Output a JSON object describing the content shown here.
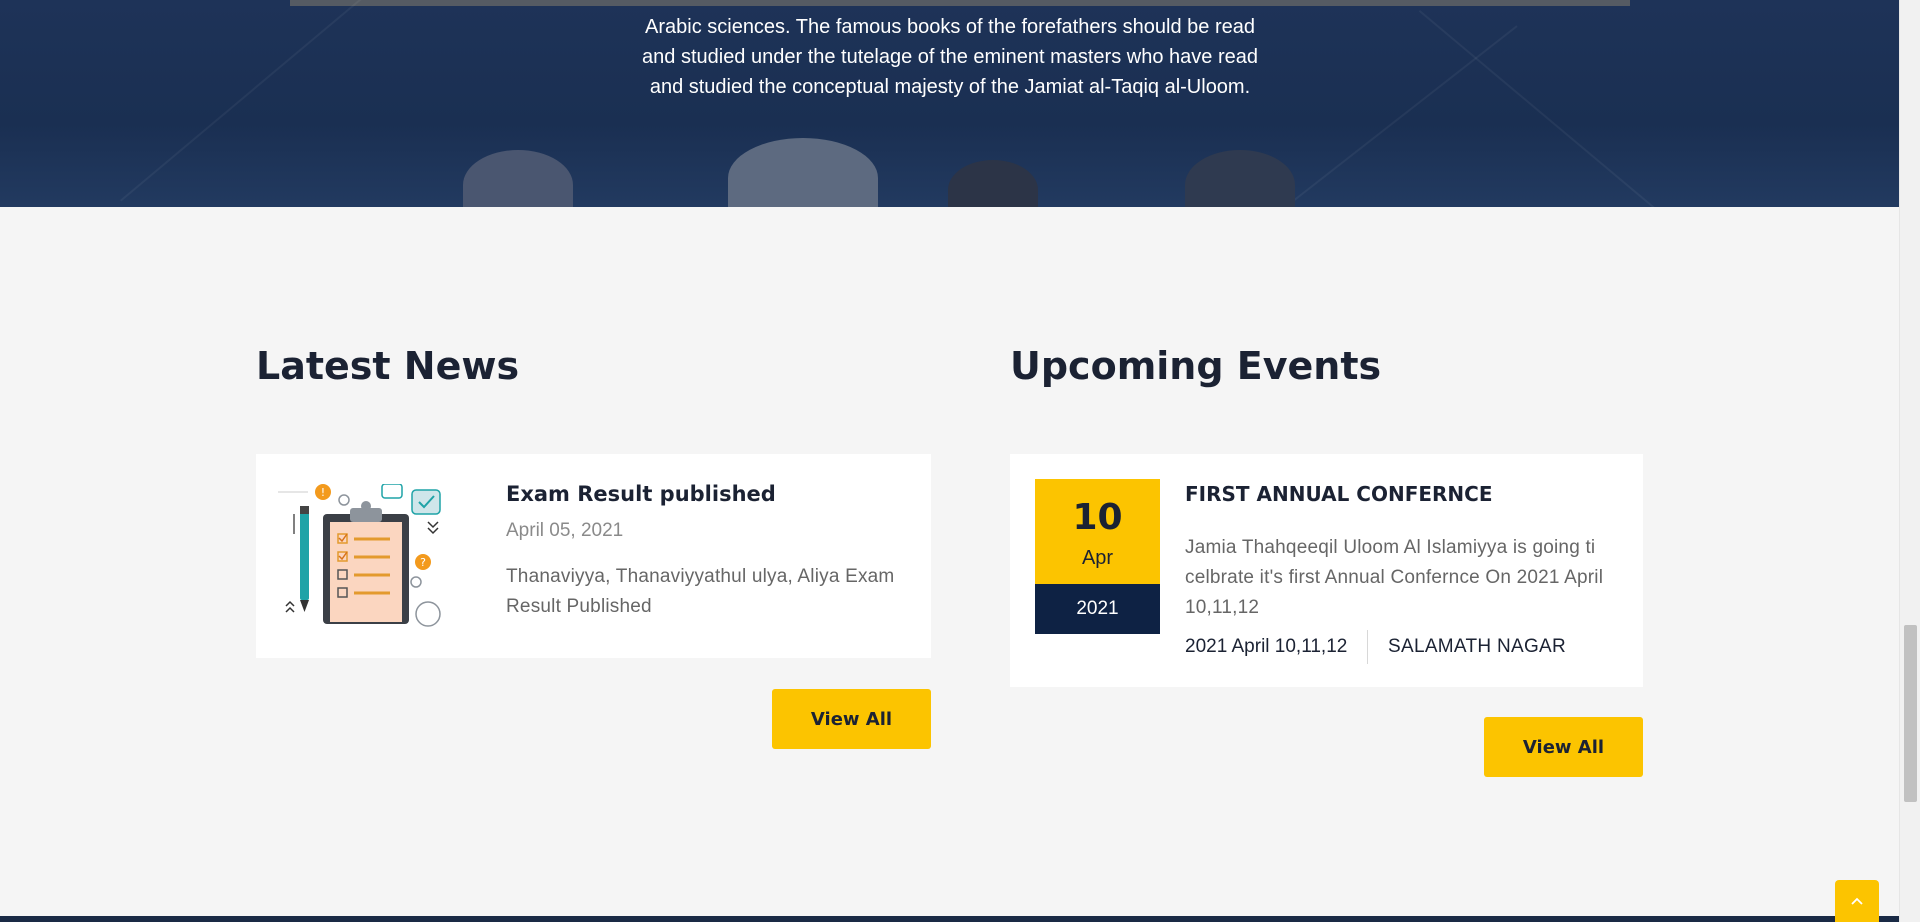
{
  "hero": {
    "lines": [
      "Arabic sciences. The famous books of the forefathers should be read",
      "and studied under the tutelage of the eminent masters who have read",
      "and studied the conceptual majesty of the Jamiat al-Taqiq al-Uloom."
    ]
  },
  "news": {
    "heading": "Latest News",
    "item": {
      "title": "Exam Result published",
      "date": "April 05, 2021",
      "summary": "Thanaviyya, Thanaviyyathul ulya, Aliya Exam Result Published",
      "image_icon": "clipboard-checklist-illustration"
    },
    "view_all_label": "View All"
  },
  "events": {
    "heading": "Upcoming Events",
    "item": {
      "day": "10",
      "month": "Apr",
      "year": "2021",
      "title": "FIRST ANNUAL CONFERNCE",
      "description": "Jamia Thahqeeqil Uloom Al Islamiyya is going ti celbrate it's first Annual Confernce On 2021 April 10,11,12",
      "meta_date": "2021 April 10,11,12",
      "location": "SALAMATH NAGAR"
    },
    "view_all_label": "View All"
  },
  "scroll_top": {
    "icon": "chevron-up-icon"
  },
  "colors": {
    "accent": "#fcc400",
    "navy": "#0e2244",
    "hero_bg": "#1e3358",
    "page_bg": "#f5f5f5",
    "heading": "#1b2233"
  }
}
